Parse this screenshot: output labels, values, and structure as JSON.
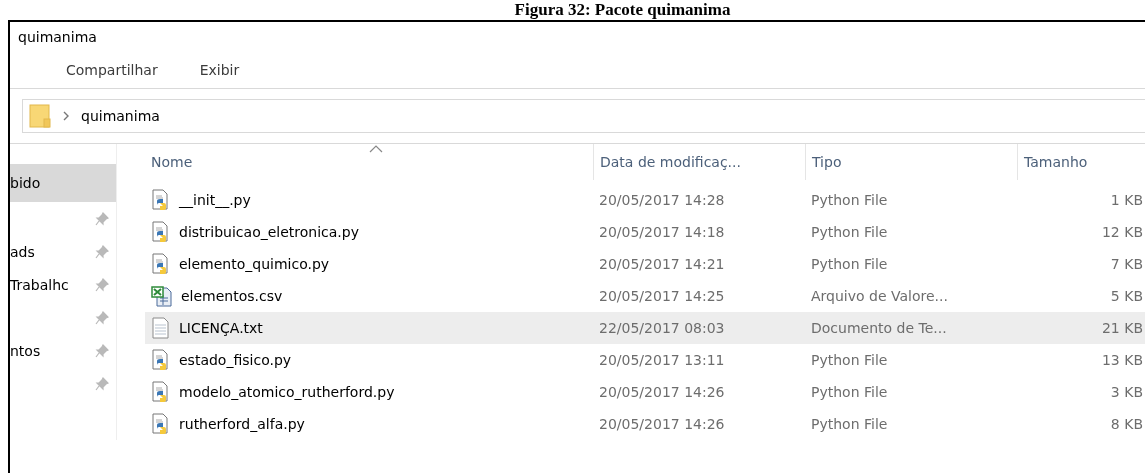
{
  "caption": "Figura 32: Pacote quimanima",
  "window": {
    "title": "quimanima"
  },
  "ribbon_tabs": [
    {
      "label": "Compartilhar"
    },
    {
      "label": "Exibir"
    }
  ],
  "address_bar": {
    "path": [
      "quimanima"
    ]
  },
  "sidebar": {
    "items": [
      {
        "label": "bido",
        "pinned": false,
        "selected": true
      },
      {
        "pinned": true,
        "selected": false
      },
      {
        "label": "ads",
        "pinned": true,
        "selected": false
      },
      {
        "label": "Trabalhc",
        "pinned": true,
        "selected": false
      },
      {
        "pinned": true,
        "selected": false
      },
      {
        "label": "ntos",
        "pinned": true,
        "selected": false
      },
      {
        "pinned": true,
        "selected": false
      }
    ]
  },
  "table": {
    "columns": [
      {
        "label": "Nome",
        "sorted": true
      },
      {
        "label": "Data de modificaç...",
        "sorted": false
      },
      {
        "label": "Tipo",
        "sorted": false
      },
      {
        "label": "Tamanho",
        "sorted": false
      }
    ],
    "rows": [
      {
        "kind": "python",
        "name": "__init__.py",
        "date": "20/05/2017 14:28",
        "type": "Python File",
        "size": "1 KB",
        "hovered": false
      },
      {
        "kind": "python",
        "name": "distribuicao_eletronica.py",
        "date": "20/05/2017 14:18",
        "type": "Python File",
        "size": "12 KB",
        "hovered": false
      },
      {
        "kind": "python",
        "name": "elemento_quimico.py",
        "date": "20/05/2017 14:21",
        "type": "Python File",
        "size": "7 KB",
        "hovered": false
      },
      {
        "kind": "csv",
        "name": "elementos.csv",
        "date": "20/05/2017 14:25",
        "type": "Arquivo de Valore...",
        "size": "5 KB",
        "hovered": false
      },
      {
        "kind": "text",
        "name": "LICENÇA.txt",
        "date": "22/05/2017 08:03",
        "type": "Documento de Te...",
        "size": "21 KB",
        "hovered": true
      },
      {
        "kind": "python",
        "name": "estado_fisico.py",
        "date": "20/05/2017 13:11",
        "type": "Python File",
        "size": "13 KB",
        "hovered": false
      },
      {
        "kind": "python",
        "name": "modelo_atomico_rutherford.py",
        "date": "20/05/2017 14:26",
        "type": "Python File",
        "size": "3 KB",
        "hovered": false
      },
      {
        "kind": "python",
        "name": "rutherford_alfa.py",
        "date": "20/05/2017 14:26",
        "type": "Python File",
        "size": "8 KB",
        "hovered": false
      }
    ]
  }
}
